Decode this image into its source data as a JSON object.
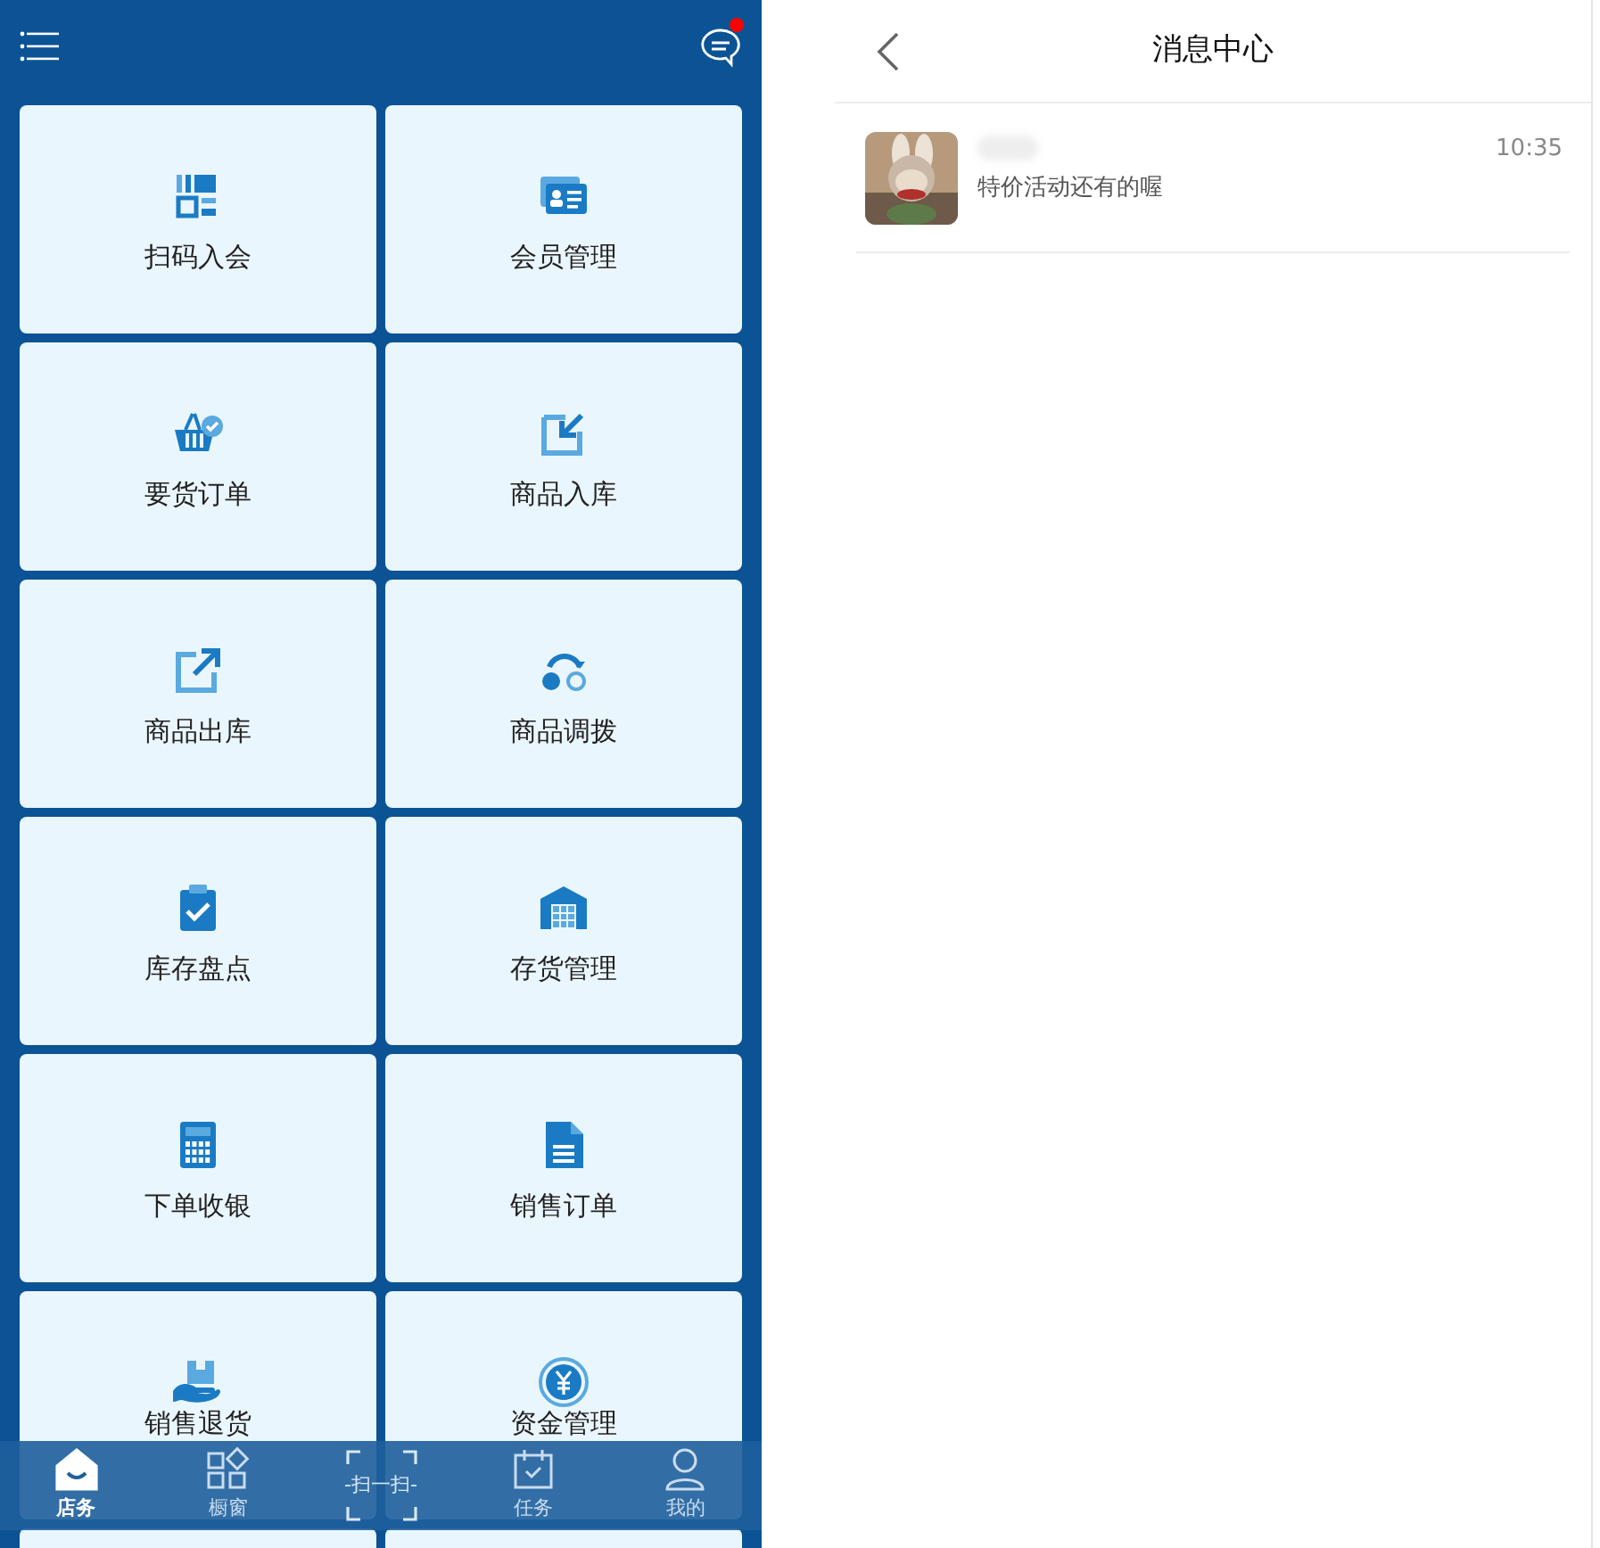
{
  "home": {
    "unread": true,
    "tiles": [
      {
        "label": "扫码入会"
      },
      {
        "label": "会员管理"
      },
      {
        "label": "要货订单"
      },
      {
        "label": "商品入库"
      },
      {
        "label": "商品出库"
      },
      {
        "label": "商品调拨"
      },
      {
        "label": "库存盘点"
      },
      {
        "label": "存货管理"
      },
      {
        "label": "下单收银"
      },
      {
        "label": "销售订单"
      },
      {
        "label": "销售退货"
      },
      {
        "label": "资金管理"
      }
    ],
    "tab_bar": [
      {
        "label": "店务",
        "selected": true,
        "kind": "tab"
      },
      {
        "label": "橱窗",
        "selected": false,
        "kind": "tab"
      },
      {
        "label": "-扫一扫-",
        "selected": false,
        "kind": "scan"
      },
      {
        "label": "任务",
        "selected": false,
        "kind": "tab"
      },
      {
        "label": "我的",
        "selected": false,
        "kind": "tab"
      }
    ]
  },
  "messages": {
    "title": "消息中心",
    "items": [
      {
        "time": "10:35",
        "text": "特价活动还有的喔"
      }
    ]
  }
}
